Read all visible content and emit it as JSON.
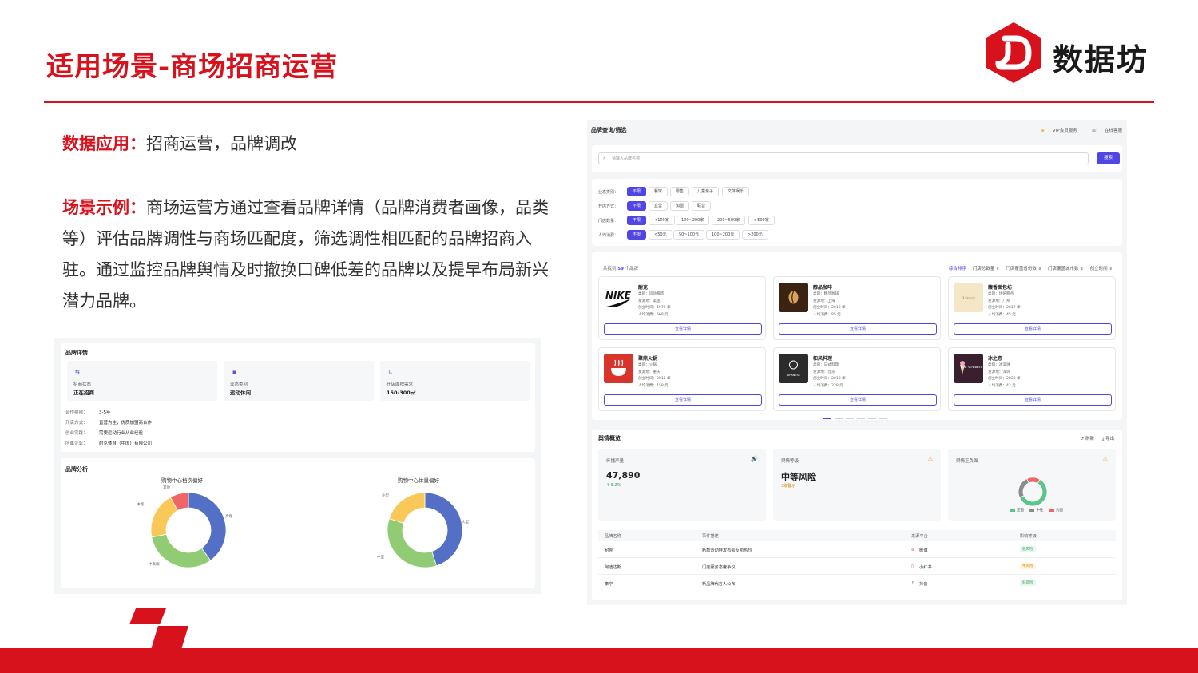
{
  "slide": {
    "title": "适用场景-商场招商运营",
    "logo_text": "数据坊",
    "logo_glyph": "D",
    "paragraph1_key": "数据应用：",
    "paragraph1_body": "招商运营，品牌调改",
    "paragraph2_key": "场景示例：",
    "paragraph2_body": "商场运营方通过查看品牌详情（品牌消费者画像，品类等）评估品牌调性与商场匹配度，筛选调性相匹配的品牌招商入驻。通过监控品牌舆情及时撤换口碑低差的品牌以及提早布局新兴潜力品牌。"
  },
  "brand_detail": {
    "header": "品牌详情",
    "stats": [
      {
        "icon": "handshake-icon",
        "label": "招商状态",
        "value": "正在招商"
      },
      {
        "icon": "store-icon",
        "label": "业态类别",
        "value": "运动休闲"
      },
      {
        "icon": "area-icon",
        "label": "开店面积需求",
        "value": "150-300㎡"
      }
    ],
    "rows": [
      {
        "key": "合作期限：",
        "value": "3-5年"
      },
      {
        "key": "开店方式：",
        "value": "直营为主，优质加盟商合作"
      },
      {
        "key": "创业实践：",
        "value": "需要运动行业从业经验"
      },
      {
        "key": "所属企业：",
        "value": "耐克体育（中国）有限公司"
      }
    ],
    "analysis_header": "品牌分析",
    "colors": {
      "blue": "#5470c6",
      "green": "#91cc75",
      "yellow": "#fac858",
      "red": "#ee6666"
    }
  },
  "chart_data": [
    {
      "type": "pie",
      "title": "购物中心档次偏好",
      "categories": [
        "高端",
        "中高端",
        "中端",
        "其他"
      ],
      "values": [
        40,
        32,
        20,
        8
      ]
    },
    {
      "type": "pie",
      "title": "购物中心体量偏好",
      "categories": [
        "大型",
        "中型",
        "小型"
      ],
      "values": [
        45,
        35,
        20
      ]
    }
  ],
  "query": {
    "header": "品牌查询/筛选",
    "vip": "VIP会员服务",
    "service": "在线客服",
    "search_placeholder": "请输入品牌名称",
    "search_button": "搜索",
    "filters": [
      {
        "label": "业态类别：",
        "options": [
          "不限",
          "餐饮",
          "零售",
          "儿童亲子",
          "文体娱乐"
        ]
      },
      {
        "label": "开店方式：",
        "options": [
          "不限",
          "直营",
          "加盟",
          "联营"
        ]
      },
      {
        "label": "门店数量：",
        "options": [
          "不限",
          "<100家",
          "100~200家",
          "200~500家",
          ">500家"
        ]
      },
      {
        "label": "人均消费：",
        "options": [
          "不限",
          "<50元",
          "50~100元",
          "100~200元",
          ">200元"
        ]
      }
    ],
    "count_prefix": "共找到",
    "count_value": "59",
    "count_suffix": "个品牌",
    "sorts": [
      "综合排序",
      "门店总数量 ⇕",
      "门店覆盖省份数 ⇕",
      "门店覆盖城市数 ⇕",
      "创立时间 ⇕"
    ],
    "detail_button": "查看详情",
    "brands": [
      {
        "name": "耐克",
        "category": "类目：运动服饰",
        "origin": "发源地：美国",
        "founded": "创立时间：1972 年",
        "price": "人均消费：568 元",
        "logo": "NIKE",
        "logo_bg": "#ffffff",
        "logo_fg": "#111111"
      },
      {
        "name": "醇品咖啡",
        "category": "类目：精品咖啡",
        "origin": "发源地：上海",
        "founded": "创立时间：2019 年",
        "price": "人均消费：85 元",
        "logo": "☕",
        "logo_bg": "#3b2314",
        "logo_fg": "#d9a35a"
      },
      {
        "name": "馥香面包坊",
        "category": "类目：烘焙甜点",
        "origin": "发源地：广州",
        "founded": "创立时间：2017 年",
        "price": "人均消费：45 元",
        "logo": "Bakery",
        "logo_bg": "#f5e6c8",
        "logo_fg": "#b08a4a"
      },
      {
        "name": "聚鼎火锅",
        "category": "类目：火锅",
        "origin": "发源地：重庆",
        "founded": "创立时间：2015 年",
        "price": "人均消费：158 元",
        "logo": "🍜",
        "logo_bg": "#d9342b",
        "logo_fg": "#ffffff"
      },
      {
        "name": "和风料理",
        "category": "类目：日式料理",
        "origin": "发源地：北京",
        "founded": "创立时间：2018 年",
        "price": "人均消费：228 元",
        "logo": "JAPANESE",
        "logo_bg": "#2c2c2c",
        "logo_fg": "#ffffff"
      },
      {
        "name": "冰之恋",
        "category": "类目：冰淇淋",
        "origin": "发源地：深圳",
        "founded": "创立时间：2020 年",
        "price": "人均消费：42 元",
        "logo": "ice cream",
        "logo_bg": "#3a1f2e",
        "logo_fg": "#ffffff"
      }
    ]
  },
  "opinion": {
    "header": "舆情概览",
    "refresh": "⟳ 刷新",
    "export": "⤓ 导出",
    "metrics": [
      {
        "label": "传播声量",
        "value": "47,890",
        "sub": "↑ 8.2%",
        "sub_color": "#2f9e5a",
        "icon": "🔊",
        "icon_color": "#4f46e5"
      },
      {
        "label": "舆情等级",
        "value": "中等风险",
        "sub": "3级警示",
        "sub_color": "#d48806",
        "icon": "⚠",
        "icon_color": "#e6a700"
      },
      {
        "label": "舆情正负面",
        "value": "",
        "sub": "",
        "sub_color": "#555",
        "icon": "⚠",
        "icon_color": "#e6a700"
      }
    ],
    "sentiment_legend": [
      "正面",
      "中性",
      "负面"
    ],
    "sentiment_values": [
      60,
      25,
      15
    ],
    "sentiment_colors": [
      "#5ec48b",
      "#8c8c8c",
      "#ee6666"
    ],
    "table_headers": [
      "品牌名称",
      "事件描述",
      "来源平台",
      "影响等级"
    ],
    "rows": [
      {
        "brand": "耐克",
        "event": "新款运动鞋发布会反响热烈",
        "platform": "微博",
        "platform_icon": "⊛",
        "level": "低风险",
        "level_type": "low"
      },
      {
        "brand": "阿迪达斯",
        "event": "门店服务态度争议",
        "platform": "小红书",
        "platform_icon": "▯",
        "level": "中风险",
        "level_type": "mid"
      },
      {
        "brand": "李宁",
        "event": "新品牌代言人公布",
        "platform": "抖音",
        "platform_icon": "♪",
        "level": "低风险",
        "level_type": "low"
      }
    ]
  }
}
